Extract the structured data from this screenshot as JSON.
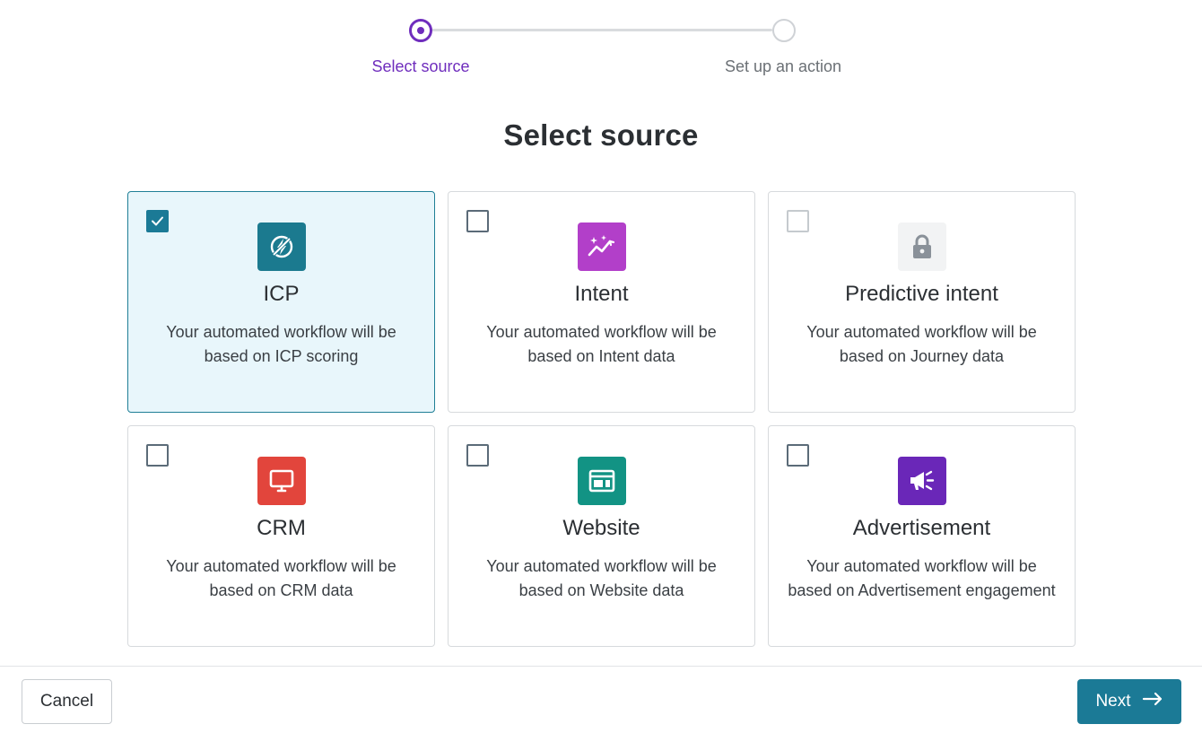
{
  "stepper": {
    "steps": [
      {
        "label": "Select source",
        "state": "active"
      },
      {
        "label": "Set up an action",
        "state": "inactive"
      }
    ]
  },
  "page": {
    "title": "Select source"
  },
  "colors": {
    "accent_purple": "#6f2dbd",
    "accent_teal": "#1b7a96",
    "selected_bg": "#e8f6fb"
  },
  "sources": [
    {
      "name": "ICP",
      "description": "Your automated workflow will be based on ICP scoring",
      "checked": true,
      "locked": false,
      "icon": "lightning-bolt-icon",
      "icon_color": "#1b7a8f"
    },
    {
      "name": "Intent",
      "description": "Your automated workflow will be based on Intent data",
      "checked": false,
      "locked": false,
      "icon": "sparkle-trend-icon",
      "icon_color": "#b23fc9"
    },
    {
      "name": "Predictive intent",
      "description": "Your automated workflow will be based on Journey data",
      "checked": false,
      "locked": true,
      "icon": "lock-icon",
      "icon_color": "#f2f3f4"
    },
    {
      "name": "CRM",
      "description": "Your automated workflow will be based on CRM data",
      "checked": false,
      "locked": false,
      "icon": "monitor-icon",
      "icon_color": "#e2453c"
    },
    {
      "name": "Website",
      "description": "Your automated workflow will be based on Website data",
      "checked": false,
      "locked": false,
      "icon": "browser-window-icon",
      "icon_color": "#129384"
    },
    {
      "name": "Advertisement",
      "description": "Your automated workflow will be based on Advertisement engagement",
      "checked": false,
      "locked": false,
      "icon": "megaphone-icon",
      "icon_color": "#6a27b8"
    }
  ],
  "footer": {
    "cancel_label": "Cancel",
    "next_label": "Next"
  }
}
